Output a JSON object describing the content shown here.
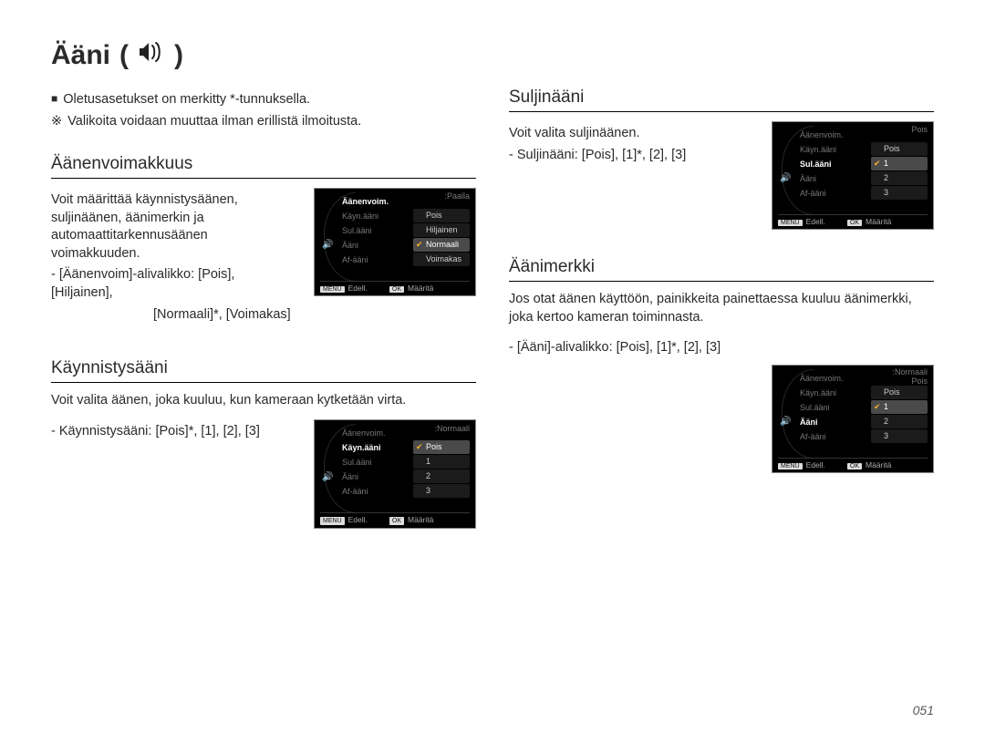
{
  "page": {
    "title": "Ääni",
    "paren_open": " ( ",
    "paren_close": " )",
    "number": "051"
  },
  "intro": {
    "line1": "Oletusasetukset on merkitty *-tunnuksella.",
    "line2": "Valikoita voidaan muuttaa ilman erillistä ilmoitusta."
  },
  "sections": {
    "volume": {
      "heading": "Äänenvoimakkuus",
      "body": "Voit määrittää käynnistysäänen, suljinäänen, äänimerkin ja automaattitarkennusäänen voimakkuuden.",
      "opt_a": "- [Äänenvoim]-alivalikko: [Pois], [Hiljainen],",
      "opt_b": "[Normaali]*, [Voimakas]"
    },
    "start": {
      "heading": "Käynnistysääni",
      "body": "Voit valita äänen, joka kuuluu, kun kameraan kytketään virta.",
      "opt": "- Käynnistysääni: [Pois]*, [1], [2], [3]"
    },
    "shutter": {
      "heading": "Suljinääni",
      "body": "Voit valita suljinäänen.",
      "opt": "- Suljinääni: [Pois], [1]*, [2], [3]"
    },
    "beep": {
      "heading": "Äänimerkki",
      "body": "Jos otat äänen käyttöön, painikkeita painettaessa kuuluu äänimerkki, joka kertoo kameran toiminnasta.",
      "opt": "- [Ääni]-alivalikko: [Pois], [1]*, [2], [3]"
    }
  },
  "screenshots": {
    "menu_items": {
      "i0": "Äänenvoim.",
      "i1": "Käyn.ääni",
      "i2": "Sul.ääni",
      "i3": "Ääni",
      "i4": "Af-ääni"
    },
    "footer": {
      "back": "Edell.",
      "set": "Määritä",
      "back_tag": "MENU",
      "set_tag": "OK"
    },
    "vol_right_label": ":Paalla",
    "vol_opts": {
      "o0": "Pois",
      "o1": "Hiljainen",
      "o2": "Normaali",
      "o3": "Voimakas"
    },
    "start_right_label": ":Normaali",
    "num_opts": {
      "o0": "Pois",
      "o1": "1",
      "o2": "2",
      "o3": "3"
    },
    "shutter_right_label": "Pois",
    "beep_right_label": ":Normaali\nPois"
  }
}
